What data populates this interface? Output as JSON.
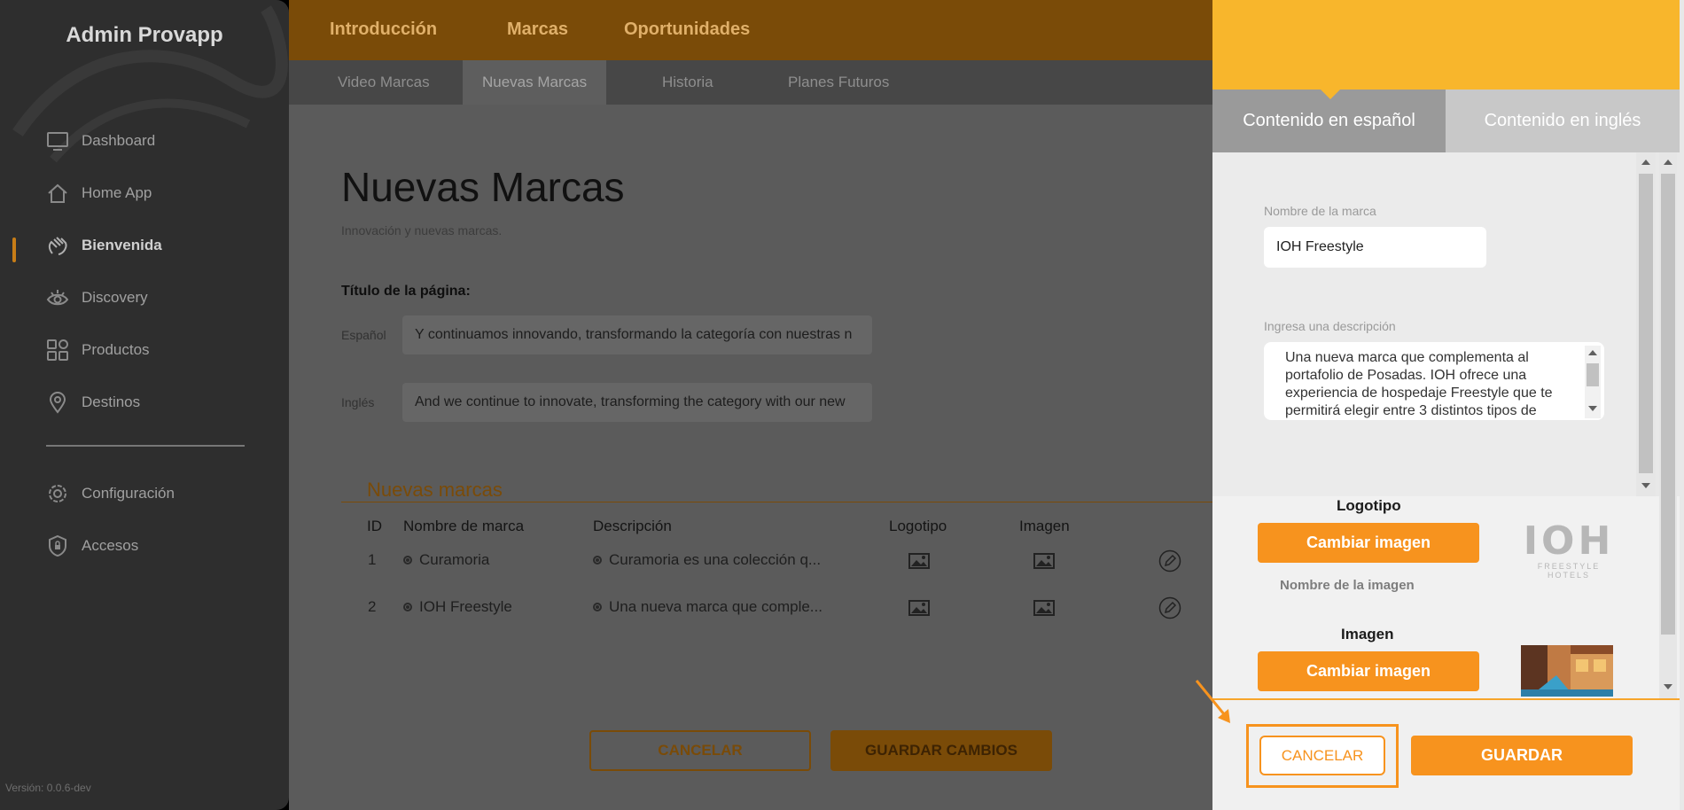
{
  "sidebar": {
    "brand": "Admin Provapp",
    "items": [
      {
        "label": "Dashboard",
        "icon": "monitor-icon"
      },
      {
        "label": "Home App",
        "icon": "home-icon"
      },
      {
        "label": "Bienvenida",
        "icon": "hand-wave-icon",
        "active": true
      },
      {
        "label": "Discovery",
        "icon": "eye-icon"
      },
      {
        "label": "Productos",
        "icon": "grid-icon"
      },
      {
        "label": "Destinos",
        "icon": "map-pin-icon"
      },
      {
        "label": "Configuración",
        "icon": "gear-icon"
      },
      {
        "label": "Accesos",
        "icon": "shield-lock-icon"
      }
    ],
    "version": "Versión: 0.0.6-dev"
  },
  "topnav": {
    "tabs": [
      "Introducción",
      "Marcas",
      "Oportunidades"
    ]
  },
  "subnav": {
    "tabs": [
      "Video Marcas",
      "Nuevas Marcas",
      "Historia",
      "Planes Futuros"
    ],
    "active": "Nuevas Marcas"
  },
  "main": {
    "title": "Nuevas Marcas",
    "subtitle": "Innovación y nuevas marcas.",
    "page_title_label": "Título de la página:",
    "spanish_label": "Español",
    "spanish_value": "Y continuamos innovando, transformando la categoría con nuestras n",
    "english_label": "Inglés",
    "english_value": "And we continue to innovate, transforming the category with our new",
    "table_title": "Nuevas marcas",
    "columns": [
      "ID",
      "Nombre de marca",
      "Descripción",
      "Logotipo",
      "Imagen"
    ],
    "rows": [
      {
        "id": "1",
        "name": "Curamoria",
        "description": "Curamoria es una colección q..."
      },
      {
        "id": "2",
        "name": "IOH Freestyle",
        "description": "Una nueva marca que comple..."
      }
    ],
    "cancel_label": "CANCELAR",
    "save_label": "GUARDAR CAMBIOS"
  },
  "panel": {
    "tab_es": "Contenido en español",
    "tab_en": "Contenido en inglés",
    "brand_name_label": "Nombre de la marca",
    "brand_name_value": "IOH Freestyle",
    "description_label": "Ingresa una descripción",
    "description_value": "Una nueva marca que complementa al portafolio de Posadas. IOH ofrece una experiencia de hospedaje Freestyle que te permitirá elegir entre 3 distintos tipos de",
    "logo_heading": "Logotipo",
    "change_image_label": "Cambiar imagen",
    "image_name_label": "Nombre de la imagen",
    "image_heading": "Imagen",
    "logo_text": "IOH",
    "logo_subtext": "FREESTYLE HOTELS",
    "cancel_label": "CANCELAR",
    "save_label": "GUARDAR"
  },
  "colors": {
    "accent": "#f7931e",
    "header": "#f8b62c",
    "sidebar": "#2e2e2e"
  }
}
